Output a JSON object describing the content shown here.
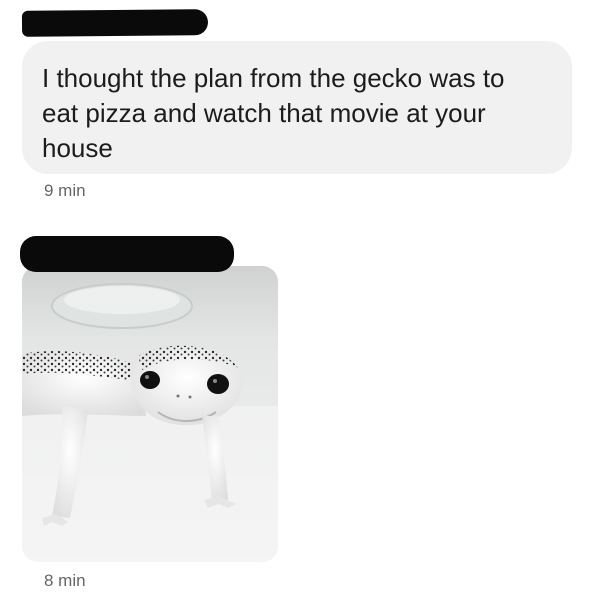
{
  "messages": [
    {
      "text": "I thought the plan from the gecko was to eat pizza and watch that movie at your house",
      "time": "9 min"
    },
    {
      "image": "leopard-gecko-photo",
      "time": "8 min"
    }
  ],
  "colors": {
    "bubble": "#f1f1f1",
    "text": "#1c1c1c",
    "timestamp": "#666666",
    "redaction": "#0a0a0a"
  }
}
